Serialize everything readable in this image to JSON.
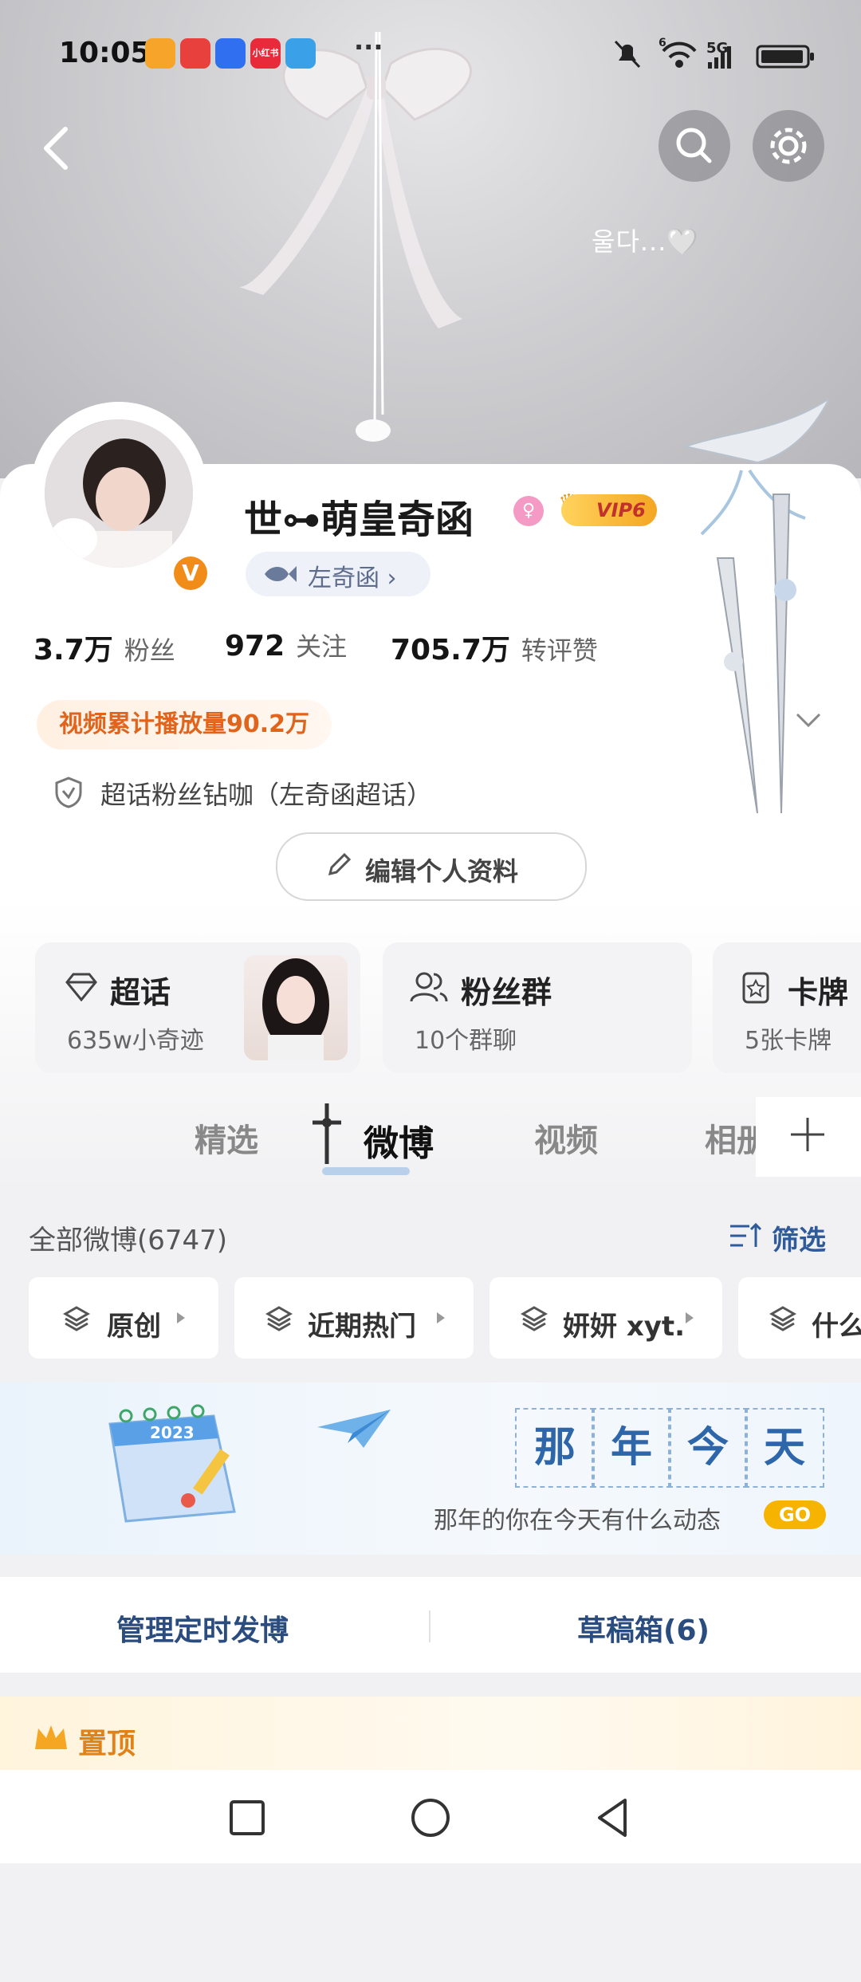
{
  "status_bar": {
    "time": "10:05",
    "app_icons": [
      {
        "name": "heart-app-icon",
        "color": "#f5a623"
      },
      {
        "name": "shopping-app-icon",
        "color": "#e8403c"
      },
      {
        "name": "appmarket-icon",
        "color": "#2f6ff0"
      },
      {
        "name": "xiaohongshu-icon",
        "color": "#e92a3b",
        "label": "小红书"
      },
      {
        "name": "book-app-icon",
        "color": "#3aa0e8"
      }
    ],
    "more": "···",
    "network": "5G",
    "wifi_badge": "6"
  },
  "header": {
    "overlay_text": "울다...🤍"
  },
  "profile": {
    "username": "世⊶萌皇奇函",
    "vip_label": "VIP6",
    "tag": "左奇函",
    "tag_arrow": "›",
    "verified_badge": "V",
    "stats": [
      {
        "value": "3.7万",
        "label": "粉丝"
      },
      {
        "value": "972",
        "label": "关注"
      },
      {
        "value": "705.7万",
        "label": "转评赞"
      }
    ],
    "video_plays": "视频累计播放量90.2万",
    "super_fan": "超话粉丝钻咖（左奇函超话）",
    "edit_button": "编辑个人资料"
  },
  "feature_cards": [
    {
      "title": "超话",
      "subtitle": "635w小奇迹"
    },
    {
      "title": "粉丝群",
      "subtitle": "10个群聊"
    },
    {
      "title": "卡牌",
      "subtitle": "5张卡牌"
    }
  ],
  "tabs": [
    "精选",
    "微博",
    "视频",
    "相册"
  ],
  "active_tab": "微博",
  "feed": {
    "all_label": "全部微博(6747)",
    "filter_label": "筛选",
    "chips": [
      "原创",
      "近期热门",
      "妍妍 xyt.",
      "什么"
    ]
  },
  "memory_banner": {
    "chars": [
      "那",
      "年",
      "今",
      "天"
    ],
    "subtitle": "那年的你在今天有什么动态",
    "go": "GO",
    "calendar_year": "2023"
  },
  "actions": {
    "scheduled": "管理定时发博",
    "drafts": "草稿箱(6)"
  },
  "pinned": {
    "label": "置顶"
  }
}
